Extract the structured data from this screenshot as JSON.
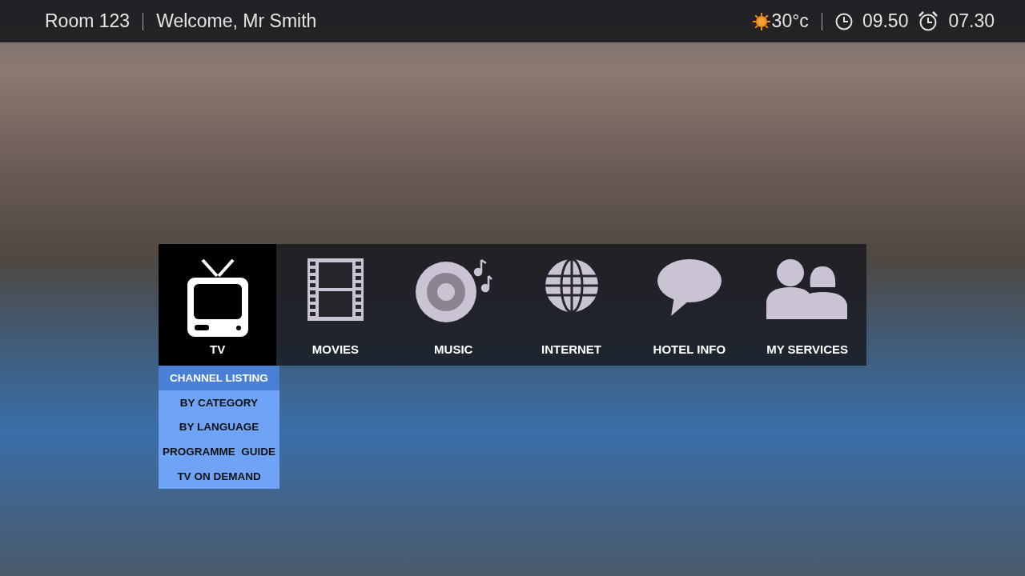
{
  "top_bar": {
    "room": "Room 123",
    "welcome": "Welcome, Mr Smith",
    "temperature": "30°c",
    "time": "09.50",
    "alarm": "07.30"
  },
  "menu": [
    {
      "label": "TV",
      "kind": "tv",
      "selected": true
    },
    {
      "label": "MOVIES",
      "kind": "film",
      "selected": false
    },
    {
      "label": "MUSIC",
      "kind": "music",
      "selected": false
    },
    {
      "label": "INTERNET",
      "kind": "globe",
      "selected": false
    },
    {
      "label": "HOTEL INFO",
      "kind": "speech",
      "selected": false
    },
    {
      "label": "MY SERVICES",
      "kind": "people",
      "selected": false
    }
  ],
  "submenu": [
    {
      "label": "CHANNEL LISTING",
      "selected": true
    },
    {
      "label": "BY CATEGORY",
      "selected": false
    },
    {
      "label": "BY LANGUAGE",
      "selected": false
    },
    {
      "label": "PROGRAMME  GUIDE",
      "selected": false
    },
    {
      "label": "TV ON DEMAND",
      "selected": false
    }
  ]
}
